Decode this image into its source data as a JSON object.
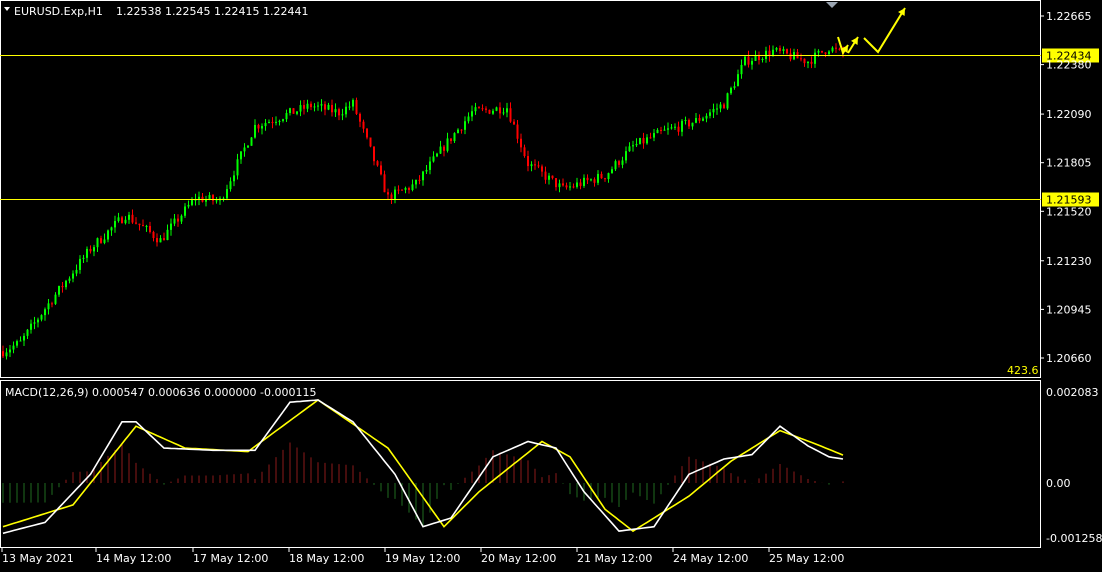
{
  "header": {
    "symbol_line": "EURUSD.Exp,H1",
    "ohlc": "1.22538 1.22545 1.22415 1.22441"
  },
  "price_axis": {
    "labels": [
      "1.22665",
      "1.22380",
      "1.22090",
      "1.21805",
      "1.21520",
      "1.21230",
      "1.20945",
      "1.20660"
    ],
    "values": [
      1.22665,
      1.2238,
      1.2209,
      1.21805,
      1.2152,
      1.2123,
      1.20945,
      1.2066
    ]
  },
  "levels": [
    {
      "label": "1.22434",
      "value": 1.22434
    },
    {
      "label": "1.21593",
      "value": 1.21593
    }
  ],
  "scale_badge": "423.6",
  "macd": {
    "header": "MACD(12,26,9) 0.000547 0.000636 0.000000 -0.000115",
    "axis_labels": [
      "0.002083",
      "0.00",
      "-0.001258"
    ],
    "axis_values": [
      0.002083,
      0.0,
      -0.001258
    ]
  },
  "time_axis": {
    "labels": [
      "13 May 2021",
      "14 May 12:00",
      "17 May 12:00",
      "18 May 12:00",
      "19 May 12:00",
      "20 May 12:00",
      "21 May 12:00",
      "24 May 12:00",
      "25 May 12:00"
    ]
  },
  "colors": {
    "background": "#000000",
    "bull": "#00ff00",
    "bear": "#ff0000",
    "level_line": "#ffff00",
    "grid_text": "#ffffff",
    "macd_signal": "#ffff00",
    "macd_main": "#ffffff",
    "hist_pos": "#8b1a1a",
    "hist_neg": "#1f6b1f",
    "arrow": "#ffff00"
  },
  "chart_data": {
    "type": "candlestick",
    "title": "EURUSD.Exp,H1",
    "ylim": [
      1.2055,
      1.2276
    ],
    "anchors": [
      {
        "i": 0,
        "p": 1.207
      },
      {
        "i": 5,
        "p": 1.2075
      },
      {
        "i": 12,
        "p": 1.2095
      },
      {
        "i": 25,
        "p": 1.213
      },
      {
        "i": 35,
        "p": 1.215
      },
      {
        "i": 45,
        "p": 1.2135
      },
      {
        "i": 55,
        "p": 1.216
      },
      {
        "i": 62,
        "p": 1.2158
      },
      {
        "i": 72,
        "p": 1.2202
      },
      {
        "i": 80,
        "p": 1.2208
      },
      {
        "i": 88,
        "p": 1.2214
      },
      {
        "i": 96,
        "p": 1.221
      },
      {
        "i": 100,
        "p": 1.2215
      },
      {
        "i": 110,
        "p": 1.216
      },
      {
        "i": 118,
        "p": 1.2168
      },
      {
        "i": 126,
        "p": 1.219
      },
      {
        "i": 134,
        "p": 1.221
      },
      {
        "i": 144,
        "p": 1.2213
      },
      {
        "i": 150,
        "p": 1.218
      },
      {
        "i": 160,
        "p": 1.2165
      },
      {
        "i": 172,
        "p": 1.2173
      },
      {
        "i": 180,
        "p": 1.219
      },
      {
        "i": 188,
        "p": 1.2198
      },
      {
        "i": 198,
        "p": 1.2205
      },
      {
        "i": 206,
        "p": 1.2215
      },
      {
        "i": 212,
        "p": 1.224
      },
      {
        "i": 220,
        "p": 1.2246
      },
      {
        "i": 230,
        "p": 1.224
      },
      {
        "i": 236,
        "p": 1.2248
      },
      {
        "i": 240,
        "p": 1.2244
      }
    ],
    "candle_count": 241,
    "levels": [
      1.22434,
      1.21593
    ],
    "macd_main": [
      {
        "i": 0,
        "v": -0.00115
      },
      {
        "i": 12,
        "v": -0.0009
      },
      {
        "i": 25,
        "v": 0.0002
      },
      {
        "i": 34,
        "v": 0.0014
      },
      {
        "i": 38,
        "v": 0.0014
      },
      {
        "i": 46,
        "v": 0.0008
      },
      {
        "i": 60,
        "v": 0.00075
      },
      {
        "i": 72,
        "v": 0.00075
      },
      {
        "i": 82,
        "v": 0.00185
      },
      {
        "i": 90,
        "v": 0.0019
      },
      {
        "i": 100,
        "v": 0.0014
      },
      {
        "i": 112,
        "v": 0.0002
      },
      {
        "i": 120,
        "v": -0.001
      },
      {
        "i": 128,
        "v": -0.0008
      },
      {
        "i": 140,
        "v": 0.0006
      },
      {
        "i": 150,
        "v": 0.00095
      },
      {
        "i": 158,
        "v": 0.0008
      },
      {
        "i": 166,
        "v": -0.0002
      },
      {
        "i": 176,
        "v": -0.0011
      },
      {
        "i": 186,
        "v": -0.001
      },
      {
        "i": 196,
        "v": 0.0002
      },
      {
        "i": 206,
        "v": 0.00055
      },
      {
        "i": 214,
        "v": 0.00065
      },
      {
        "i": 222,
        "v": 0.0013
      },
      {
        "i": 230,
        "v": 0.00085
      },
      {
        "i": 236,
        "v": 0.0006
      },
      {
        "i": 240,
        "v": 0.00055
      }
    ],
    "macd_signal": [
      {
        "i": 0,
        "v": -0.001
      },
      {
        "i": 20,
        "v": -0.0005
      },
      {
        "i": 28,
        "v": 0.0003
      },
      {
        "i": 38,
        "v": 0.0013
      },
      {
        "i": 52,
        "v": 0.0008
      },
      {
        "i": 70,
        "v": 0.00072
      },
      {
        "i": 90,
        "v": 0.0019
      },
      {
        "i": 110,
        "v": 0.0008
      },
      {
        "i": 126,
        "v": -0.001
      },
      {
        "i": 136,
        "v": -0.0002
      },
      {
        "i": 154,
        "v": 0.00095
      },
      {
        "i": 162,
        "v": 0.0006
      },
      {
        "i": 172,
        "v": -0.0006
      },
      {
        "i": 180,
        "v": -0.0011
      },
      {
        "i": 196,
        "v": -0.0003
      },
      {
        "i": 208,
        "v": 0.0005
      },
      {
        "i": 222,
        "v": 0.0012
      },
      {
        "i": 232,
        "v": 0.0009
      },
      {
        "i": 240,
        "v": 0.00064
      }
    ]
  }
}
